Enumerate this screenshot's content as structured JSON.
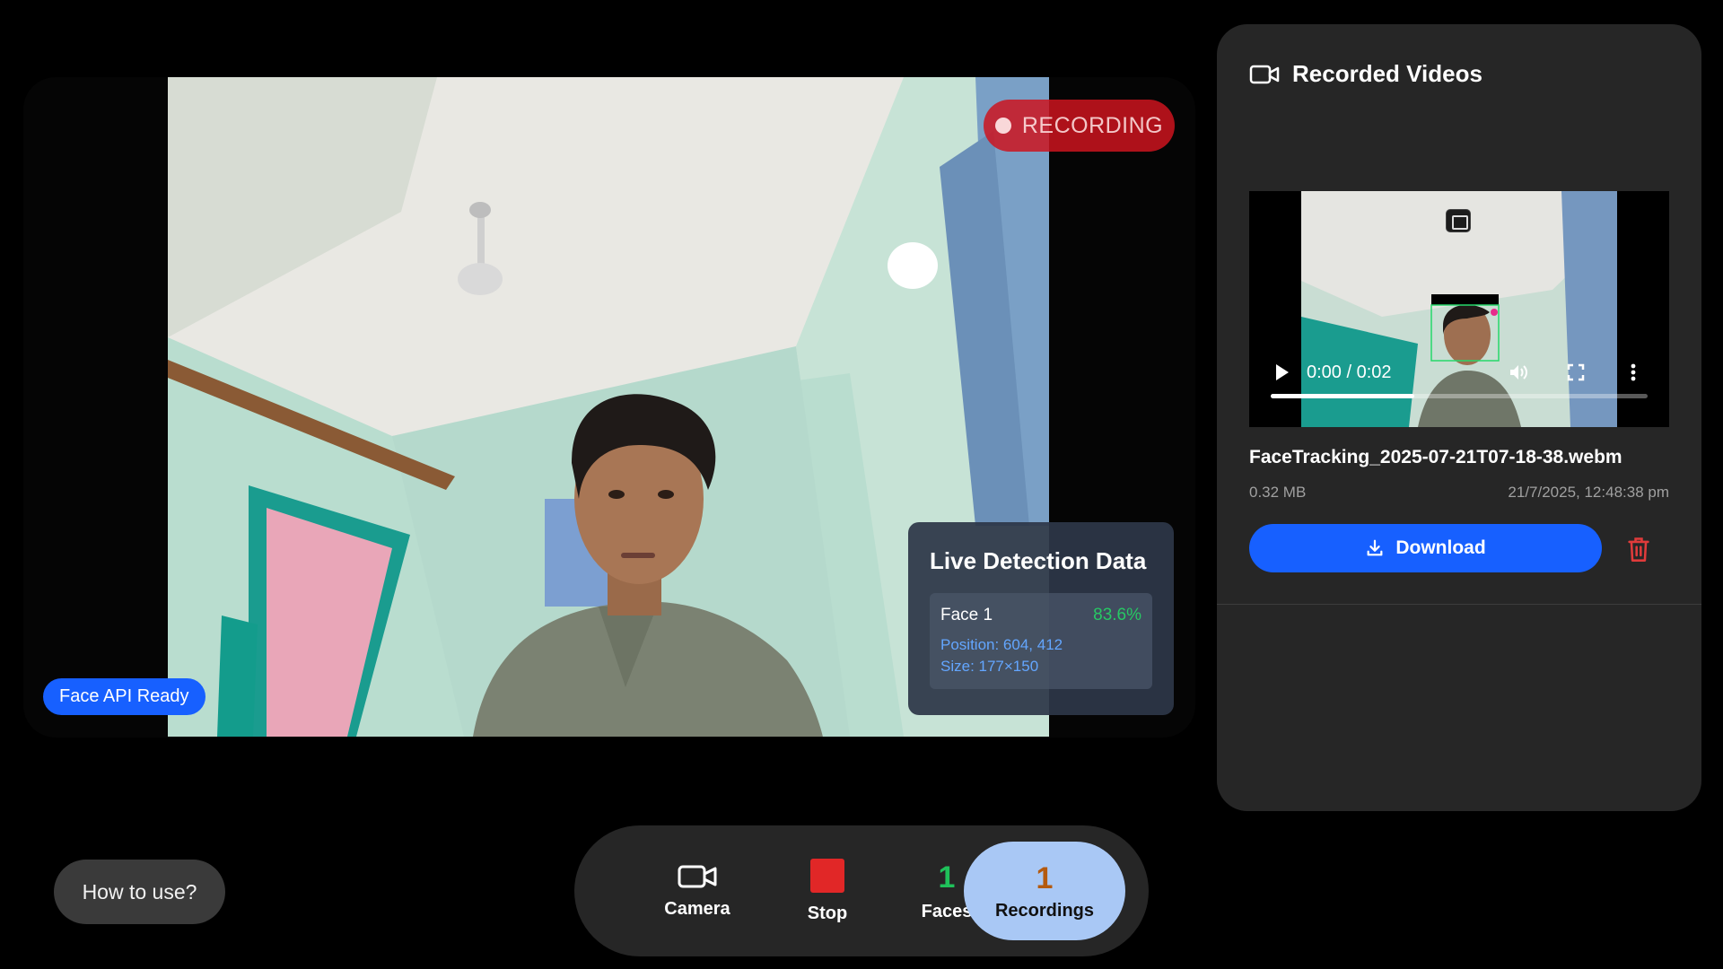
{
  "camera": {
    "recording_label": "RECORDING",
    "face_api_status": "Face API Ready"
  },
  "live_detection": {
    "title": "Live Detection Data",
    "faces": [
      {
        "label": "Face 1",
        "confidence": "83.6%",
        "position": "Position: 604, 412",
        "size": "Size: 177×150"
      }
    ]
  },
  "recorded_videos": {
    "title": "Recorded Videos",
    "header_icon": "video-camera-icon",
    "items": [
      {
        "file_name": "FaceTracking_2025-07-21T07-18-38.webm",
        "file_size": "0.32 MB",
        "date": "21/7/2025, 12:48:38 pm",
        "player_time": "0:00 / 0:02",
        "progress_fraction": 0.38,
        "download_label": "Download",
        "delete_icon": "trash-icon"
      }
    ]
  },
  "help": {
    "label": "How to use?"
  },
  "dock": {
    "camera_label": "Camera",
    "stop_label": "Stop",
    "faces_count": "1",
    "faces_label": "Faces",
    "recordings_count": "1",
    "recordings_label": "Recordings"
  },
  "colors": {
    "accent_blue": "#1760ff",
    "recording_red": "#e12727",
    "faces_green": "#1fc15a",
    "recordings_active_bg": "#a9c8f5"
  }
}
